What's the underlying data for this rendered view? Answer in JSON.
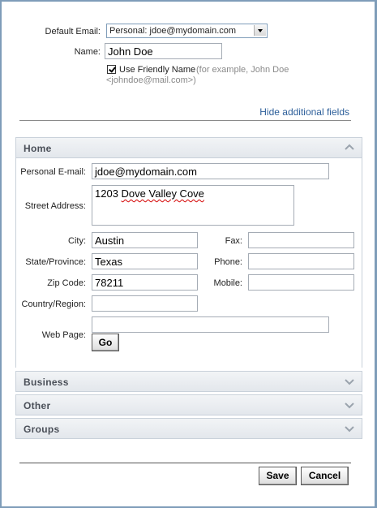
{
  "contact": {
    "default_email_label": "Default Email:",
    "default_email_value": "Personal: jdoe@mydomain.com",
    "name_label": "Name:",
    "name_value": "John Doe",
    "friendly_name_label": "Use Friendly Name",
    "friendly_name_checked": true,
    "friendly_hint_1": "(for example, John Doe",
    "friendly_hint_2": "<johndoe@mail.com>)",
    "hide_fields_link": "Hide additional fields"
  },
  "sections": {
    "home": {
      "title": "Home",
      "expanded": true
    },
    "business": {
      "title": "Business",
      "expanded": false
    },
    "other": {
      "title": "Other",
      "expanded": false
    },
    "groups": {
      "title": "Groups",
      "expanded": false
    }
  },
  "home": {
    "personal_email_label": "Personal E-mail:",
    "personal_email_value": "jdoe@mydomain.com",
    "street_label": "Street Address:",
    "street_value_1": "1203 ",
    "street_value_2": "Dove Valley Cove",
    "city_label": "City:",
    "city_value": "Austin",
    "state_label": "State/Province:",
    "state_value": "Texas",
    "zip_label": "Zip Code:",
    "zip_value": "78211",
    "country_label": "Country/Region:",
    "country_value": "",
    "fax_label": "Fax:",
    "fax_value": "",
    "phone_label": "Phone:",
    "phone_value": "",
    "mobile_label": "Mobile:",
    "mobile_value": "",
    "webpage_label": "Web Page:",
    "webpage_value": "",
    "go_button": "Go"
  },
  "footer": {
    "save_button": "Save",
    "cancel_button": "Cancel"
  },
  "colors": {
    "link": "#2d5f9a",
    "section_title": "#4a4f58",
    "border": "#7f9db9"
  },
  "icons": {
    "expanded": "chevron-up-icon",
    "collapsed": "chevron-down-icon"
  }
}
